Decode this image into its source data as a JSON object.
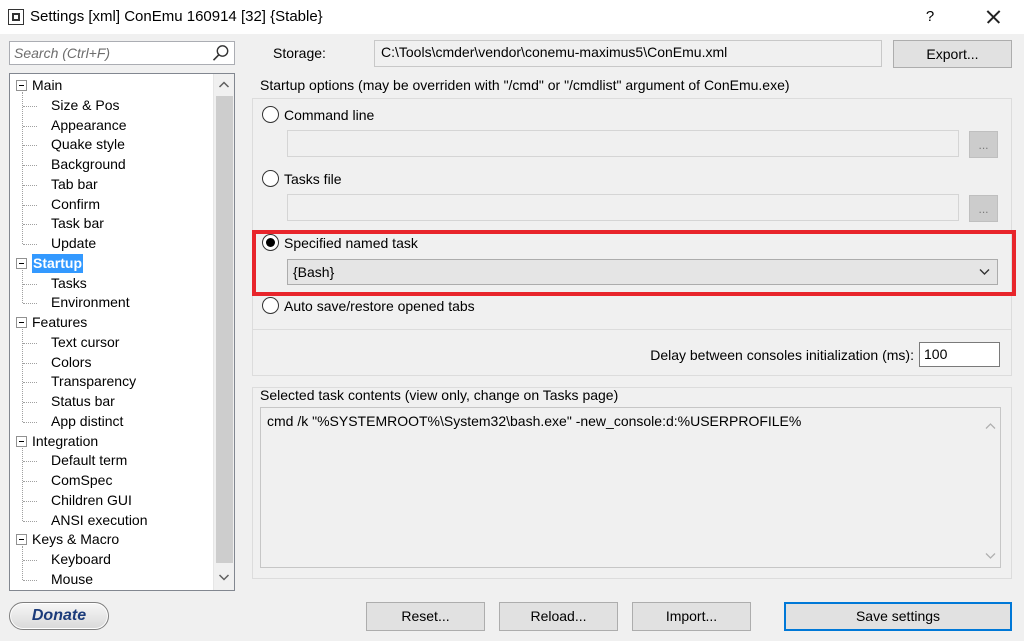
{
  "window": {
    "title": "Settings [xml] ConEmu 160914 [32] {Stable}",
    "help_label": "?"
  },
  "search": {
    "placeholder": "Search (Ctrl+F)"
  },
  "tree": {
    "items": [
      {
        "label": "Main",
        "level": 0,
        "expanded": true
      },
      {
        "label": "Size & Pos",
        "level": 1
      },
      {
        "label": "Appearance",
        "level": 1
      },
      {
        "label": "Quake style",
        "level": 1
      },
      {
        "label": "Background",
        "level": 1
      },
      {
        "label": "Tab bar",
        "level": 1
      },
      {
        "label": "Confirm",
        "level": 1
      },
      {
        "label": "Task bar",
        "level": 1
      },
      {
        "label": "Update",
        "level": 1
      },
      {
        "label": "Startup",
        "level": 0,
        "expanded": true,
        "selected": true
      },
      {
        "label": "Tasks",
        "level": 1
      },
      {
        "label": "Environment",
        "level": 1
      },
      {
        "label": "Features",
        "level": 0,
        "expanded": true
      },
      {
        "label": "Text cursor",
        "level": 1
      },
      {
        "label": "Colors",
        "level": 1
      },
      {
        "label": "Transparency",
        "level": 1
      },
      {
        "label": "Status bar",
        "level": 1
      },
      {
        "label": "App distinct",
        "level": 1
      },
      {
        "label": "Integration",
        "level": 0,
        "expanded": true
      },
      {
        "label": "Default term",
        "level": 1
      },
      {
        "label": "ComSpec",
        "level": 1
      },
      {
        "label": "Children GUI",
        "level": 1
      },
      {
        "label": "ANSI execution",
        "level": 1
      },
      {
        "label": "Keys & Macro",
        "level": 0,
        "expanded": true
      },
      {
        "label": "Keyboard",
        "level": 1
      },
      {
        "label": "Mouse",
        "level": 1
      }
    ]
  },
  "storage": {
    "label": "Storage:",
    "path": "C:\\Tools\\cmder\\vendor\\conemu-maximus5\\ConEmu.xml",
    "export_label": "Export..."
  },
  "startup": {
    "group_label": "Startup options (may be overriden with \"/cmd\" or \"/cmdlist\" argument of ConEmu.exe)",
    "command_line_label": "Command line",
    "tasks_file_label": "Tasks file",
    "named_task_label": "Specified named task",
    "named_task_value": "{Bash}",
    "auto_save_label": "Auto save/restore opened tabs",
    "browse_label": "...",
    "selected_option": "Specified named task"
  },
  "delay": {
    "label": "Delay between consoles initialization (ms):",
    "value": "100"
  },
  "task_contents": {
    "label": "Selected task contents (view only, change on Tasks page)",
    "text": "cmd /k \"%SYSTEMROOT%\\System32\\bash.exe\" -new_console:d:%USERPROFILE%"
  },
  "footer": {
    "donate_label": "Donate",
    "reset_label": "Reset...",
    "reload_label": "Reload...",
    "import_label": "Import...",
    "save_label": "Save settings"
  },
  "colors": {
    "selection": "#3399ff",
    "highlight_border": "#e8252b",
    "primary_button_border": "#0078d7"
  }
}
